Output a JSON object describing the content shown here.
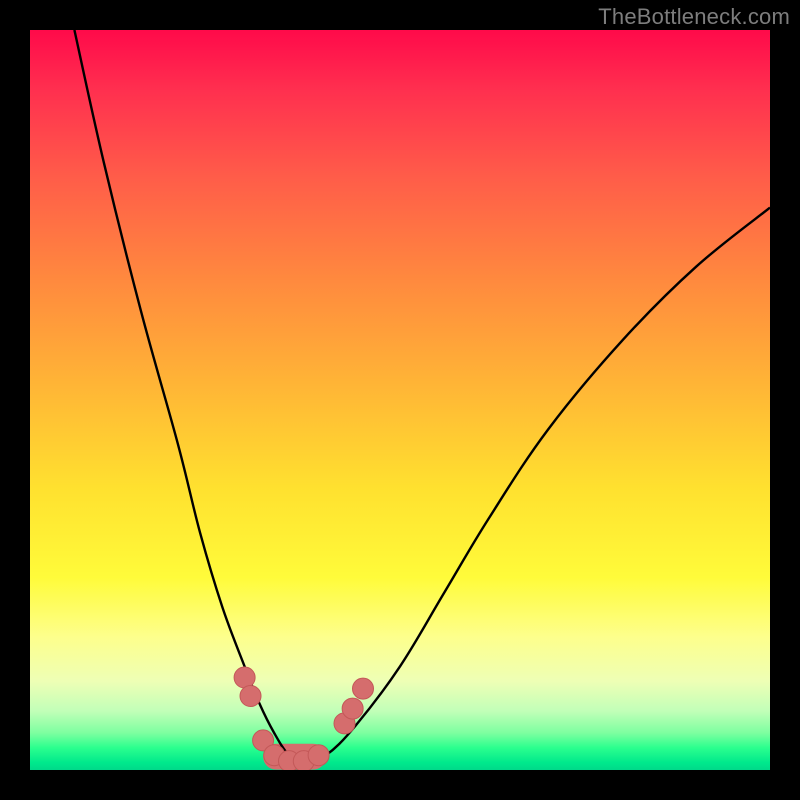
{
  "watermark": {
    "text": "TheBottleneck.com"
  },
  "colors": {
    "background": "#000000",
    "curve_stroke": "#000000",
    "marker_fill": "#d56d6d",
    "marker_stroke": "#c35858",
    "valley_fill": "#d56d6d",
    "gradient_stops": [
      "#ff0a4a",
      "#ff2f4f",
      "#ff5d49",
      "#ff8a3e",
      "#ffb536",
      "#ffe12f",
      "#fffb3a",
      "#fdff8c",
      "#eeffb5",
      "#c2ffb8",
      "#7dffa0",
      "#2bff8e",
      "#00e98c",
      "#00d98a"
    ]
  },
  "chart_data": {
    "type": "line",
    "title": "",
    "xlabel": "",
    "ylabel": "",
    "xlim": [
      0,
      100
    ],
    "ylim": [
      0,
      100
    ],
    "grid": false,
    "legend": false,
    "series": [
      {
        "name": "curve",
        "x": [
          6,
          10,
          15,
          20,
          23,
          26,
          29,
          31,
          33,
          35,
          37,
          40,
          44,
          50,
          56,
          62,
          70,
          80,
          90,
          100
        ],
        "y": [
          100,
          82,
          62,
          44,
          32,
          22,
          14,
          9,
          5,
          2,
          1,
          2,
          6,
          14,
          24,
          34,
          46,
          58,
          68,
          76
        ]
      }
    ],
    "markers": [
      {
        "x": 29.0,
        "y": 12.5
      },
      {
        "x": 29.8,
        "y": 10.0
      },
      {
        "x": 31.5,
        "y": 4.0
      },
      {
        "x": 33.0,
        "y": 2.0
      },
      {
        "x": 35.0,
        "y": 1.2
      },
      {
        "x": 37.0,
        "y": 1.2
      },
      {
        "x": 39.0,
        "y": 2.0
      },
      {
        "x": 42.5,
        "y": 6.3
      },
      {
        "x": 43.6,
        "y": 8.3
      },
      {
        "x": 45.0,
        "y": 11.0
      }
    ],
    "valley_band": {
      "x_start": 31.5,
      "x_end": 40.0,
      "y_center": 1.8,
      "thickness": 3.5
    }
  }
}
